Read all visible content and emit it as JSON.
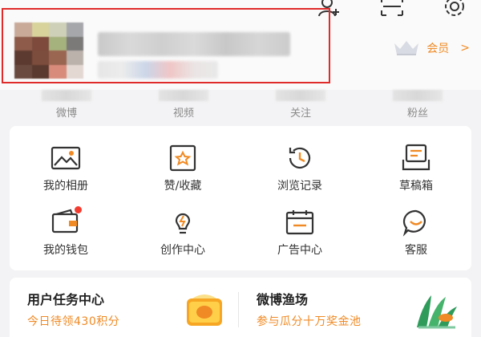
{
  "header": {
    "icons": [
      "add-friend-icon",
      "scan-icon",
      "settings-icon"
    ],
    "vip_label": "会员",
    "vip_chevron": ">",
    "highlight_color": "#e02b2b",
    "accent_color": "#f08a24"
  },
  "stats": [
    {
      "label": "微博"
    },
    {
      "label": "视频"
    },
    {
      "label": "关注"
    },
    {
      "label": "粉丝"
    }
  ],
  "menu": [
    {
      "label": "我的相册",
      "icon": "photo-album-icon"
    },
    {
      "label": "赞/收藏",
      "icon": "favorites-icon"
    },
    {
      "label": "浏览记录",
      "icon": "history-icon"
    },
    {
      "label": "草稿箱",
      "icon": "drafts-icon"
    },
    {
      "label": "我的钱包",
      "icon": "wallet-icon",
      "badge": true
    },
    {
      "label": "创作中心",
      "icon": "creator-center-icon"
    },
    {
      "label": "广告中心",
      "icon": "ad-center-icon"
    },
    {
      "label": "客服",
      "icon": "customer-service-icon"
    }
  ],
  "promo": {
    "task_title": "用户任务中心",
    "task_sub": "今日待领430积分",
    "fish_title": "微博渔场",
    "fish_sub": "参与瓜分十万奖金池"
  }
}
